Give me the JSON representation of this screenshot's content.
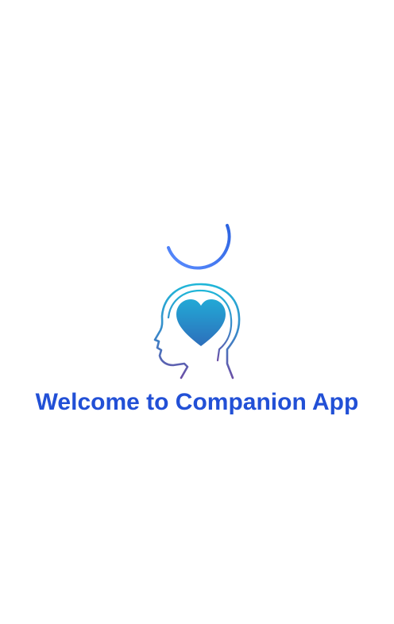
{
  "splash": {
    "title": "Welcome to Companion App",
    "title_color": "#2250d6",
    "loading_indicator": "arc-spinner",
    "spinner_color": "#3d7bf2",
    "logo_icon": "head-with-heart-icon",
    "logo_gradient": [
      "#20b6d8",
      "#6b4fa6"
    ]
  }
}
